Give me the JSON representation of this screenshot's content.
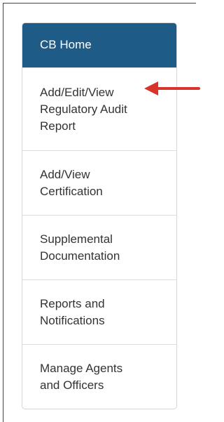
{
  "nav": {
    "items": [
      {
        "label": "CB Home"
      },
      {
        "label": "Add/Edit/View\nRegulatory Audit\nReport"
      },
      {
        "label": "Add/View\nCertification"
      },
      {
        "label": "Supplemental\nDocumentation"
      },
      {
        "label": "Reports and\nNotifications"
      },
      {
        "label": "Manage Agents\nand Officers"
      }
    ]
  },
  "annotation": {
    "icon": "red-left-arrow",
    "color": "#d9342b"
  },
  "colors": {
    "active_bg": "#1f5b87",
    "active_text": "#ffffff",
    "item_text": "#333333"
  }
}
